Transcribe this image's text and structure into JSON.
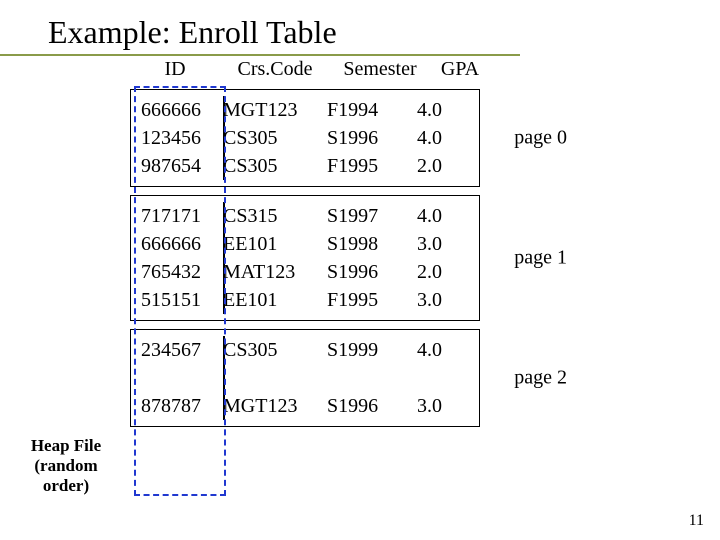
{
  "title": "Example: Enroll Table",
  "heap_label_1": "Heap File",
  "heap_label_2": "(random order)",
  "slide_number": "11",
  "headers": {
    "id": "ID",
    "crs": "Crs.Code",
    "sem": "Semester",
    "gpa": "GPA"
  },
  "pages": [
    {
      "label": "page 0",
      "rows": [
        {
          "id": "666666",
          "crs": "MGT123",
          "sem": "F1994",
          "gpa": "4.0"
        },
        {
          "id": "123456",
          "crs": "CS305",
          "sem": "S1996",
          "gpa": "4.0"
        },
        {
          "id": "987654",
          "crs": "CS305",
          "sem": "F1995",
          "gpa": "2.0"
        }
      ]
    },
    {
      "label": "page 1",
      "rows": [
        {
          "id": "717171",
          "crs": "CS315",
          "sem": "S1997",
          "gpa": "4.0"
        },
        {
          "id": "666666",
          "crs": "EE101",
          "sem": "S1998",
          "gpa": "3.0"
        },
        {
          "id": "765432",
          "crs": "MAT123",
          "sem": "S1996",
          "gpa": "2.0"
        },
        {
          "id": "515151",
          "crs": "EE101",
          "sem": "F1995",
          "gpa": "3.0"
        }
      ]
    },
    {
      "label": "page 2",
      "rows": [
        {
          "id": "234567",
          "crs": "CS305",
          "sem": "S1999",
          "gpa": "4.0"
        },
        {
          "id": "",
          "crs": "",
          "sem": "",
          "gpa": ""
        },
        {
          "id": "878787",
          "crs": "MGT123",
          "sem": "S1996",
          "gpa": "3.0"
        }
      ]
    }
  ]
}
